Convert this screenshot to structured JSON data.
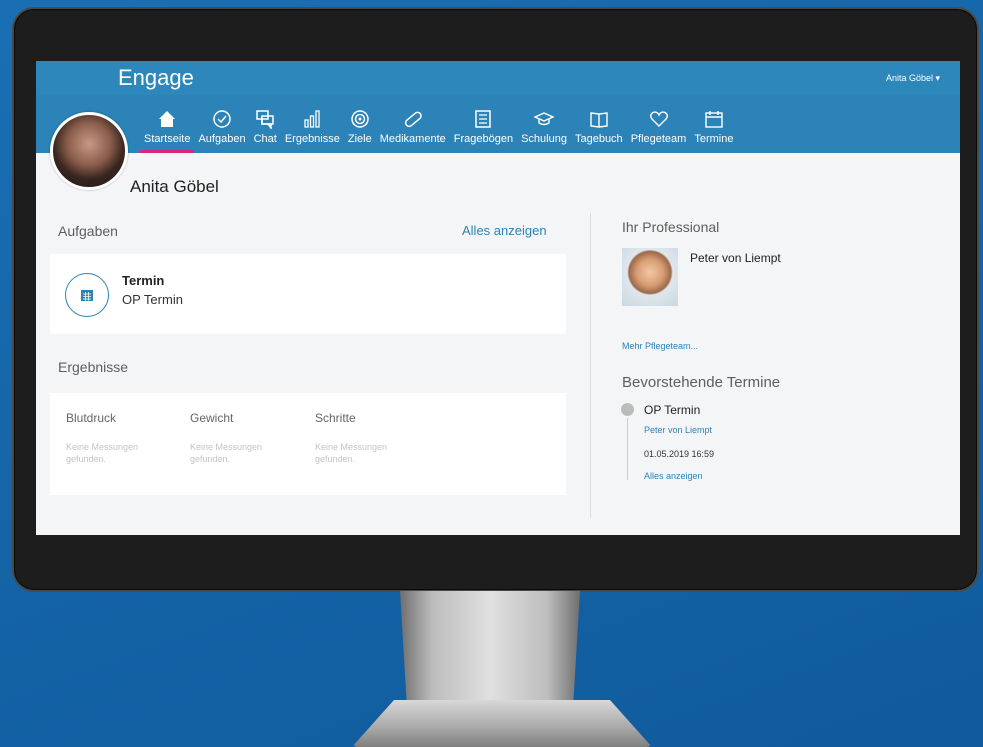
{
  "app": {
    "brand": "Engage",
    "user_menu": "Anita Göbel ▾"
  },
  "nav": {
    "items": [
      {
        "label": "Startseite",
        "icon": "home-icon",
        "active": true
      },
      {
        "label": "Aufgaben",
        "icon": "check-circle-icon",
        "active": false
      },
      {
        "label": "Chat",
        "icon": "chat-icon",
        "active": false
      },
      {
        "label": "Ergebnisse",
        "icon": "bar-chart-icon",
        "active": false
      },
      {
        "label": "Ziele",
        "icon": "target-icon",
        "active": false
      },
      {
        "label": "Medikamente",
        "icon": "pill-icon",
        "active": false
      },
      {
        "label": "Fragebögen",
        "icon": "questionnaire-icon",
        "active": false
      },
      {
        "label": "Schulung",
        "icon": "graduation-cap-icon",
        "active": false
      },
      {
        "label": "Tagebuch",
        "icon": "book-icon",
        "active": false
      },
      {
        "label": "Pflegeteam",
        "icon": "heart-icon",
        "active": false
      },
      {
        "label": "Termine",
        "icon": "calendar-icon",
        "active": false
      }
    ]
  },
  "profile": {
    "name": "Anita Göbel"
  },
  "tasks": {
    "title": "Aufgaben",
    "show_all": "Alles anzeigen",
    "item": {
      "title": "Termin",
      "subtitle": "OP Termin"
    }
  },
  "results": {
    "title": "Ergebnisse",
    "metrics": [
      {
        "label": "Blutdruck",
        "empty": "Keine Messungen gefunden."
      },
      {
        "label": "Gewicht",
        "empty": "Keine Messungen gefunden."
      },
      {
        "label": "Schritte",
        "empty": "Keine Messungen gefunden."
      }
    ]
  },
  "professional": {
    "title": "Ihr Professional",
    "name": "Peter von Liempt",
    "more_link": "Mehr Pflegeteam..."
  },
  "appointments": {
    "title": "Bevorstehende Termine",
    "item": {
      "title": "OP Termin",
      "person": "Peter von Liempt",
      "datetime": "01.05.2019 16:59"
    },
    "show_all": "Alles anzeigen"
  },
  "colors": {
    "nav_bg": "#2b83b7",
    "accent": "#d6297a",
    "link": "#2b83b7",
    "background": "#1565a8"
  }
}
